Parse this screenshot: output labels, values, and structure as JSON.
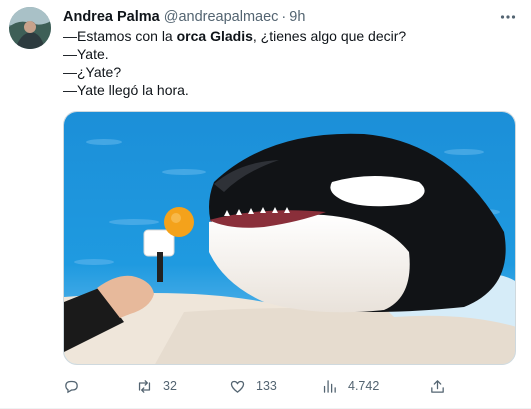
{
  "author": {
    "display_name": "Andrea Palma",
    "handle": "@andreapalmaec",
    "separator": "·",
    "time": "9h"
  },
  "tweet_text": {
    "line1_before": "—Estamos con la ",
    "line1_bold": "orca Gladis",
    "line1_after": ", ¿tienes algo que decir?",
    "line2": "—Yate.",
    "line3": "—¿Yate?",
    "line4": "—Yate llegó la hora."
  },
  "actions": {
    "replies": "",
    "retweets": "32",
    "likes": "133",
    "views": "4.742"
  },
  "icons": {
    "more": "more-dots-icon",
    "reply": "reply-bubble-icon",
    "retweet": "retweet-icon",
    "like": "heart-icon",
    "views": "views-bars-icon",
    "share": "share-upload-icon"
  },
  "colors": {
    "text": "#0f1419",
    "secondary": "#536471",
    "border": "#cfd9de"
  }
}
